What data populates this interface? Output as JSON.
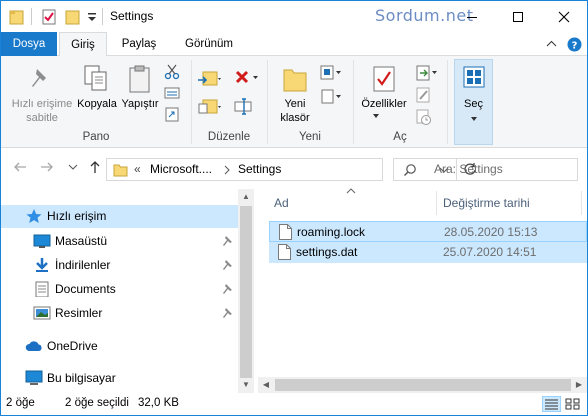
{
  "window": {
    "title": "Settings",
    "watermark": "Sordum.net"
  },
  "tabs": {
    "file": "Dosya",
    "home": "Giriş",
    "share": "Paylaş",
    "view": "Görünüm"
  },
  "ribbon": {
    "pin_label_1": "Hızlı erişime",
    "pin_label_2": "sabitle",
    "copy": "Kopyala",
    "paste": "Yapıştır",
    "group_clipboard": "Pano",
    "group_organize": "Düzenle",
    "new_folder_1": "Yeni",
    "new_folder_2": "klasör",
    "group_new": "Yeni",
    "properties": "Özellikler",
    "group_open": "Aç",
    "select": "Seç"
  },
  "address": {
    "overflow": "«",
    "crumb1": "Microsoft....",
    "crumb2": "Settings",
    "search_placeholder": "Ara: Settings"
  },
  "nav": {
    "quick_access": "Hızlı erişim",
    "desktop": "Masaüstü",
    "downloads": "İndirilenler",
    "documents": "Documents",
    "pictures": "Resimler",
    "onedrive": "OneDrive",
    "this_pc": "Bu bilgisayar"
  },
  "columns": {
    "name": "Ad",
    "modified": "Değiştirme tarihi"
  },
  "files": [
    {
      "name": "roaming.lock",
      "date": "28.05.2020 15:13"
    },
    {
      "name": "settings.dat",
      "date": "25.07.2020 14:51"
    }
  ],
  "status": {
    "count": "2 öğe",
    "selected": "2 öğe seçildi",
    "size": "32,0 KB"
  },
  "colors": {
    "accent": "#1979ca",
    "selection": "#cce8ff",
    "folder": "#f8d775"
  }
}
